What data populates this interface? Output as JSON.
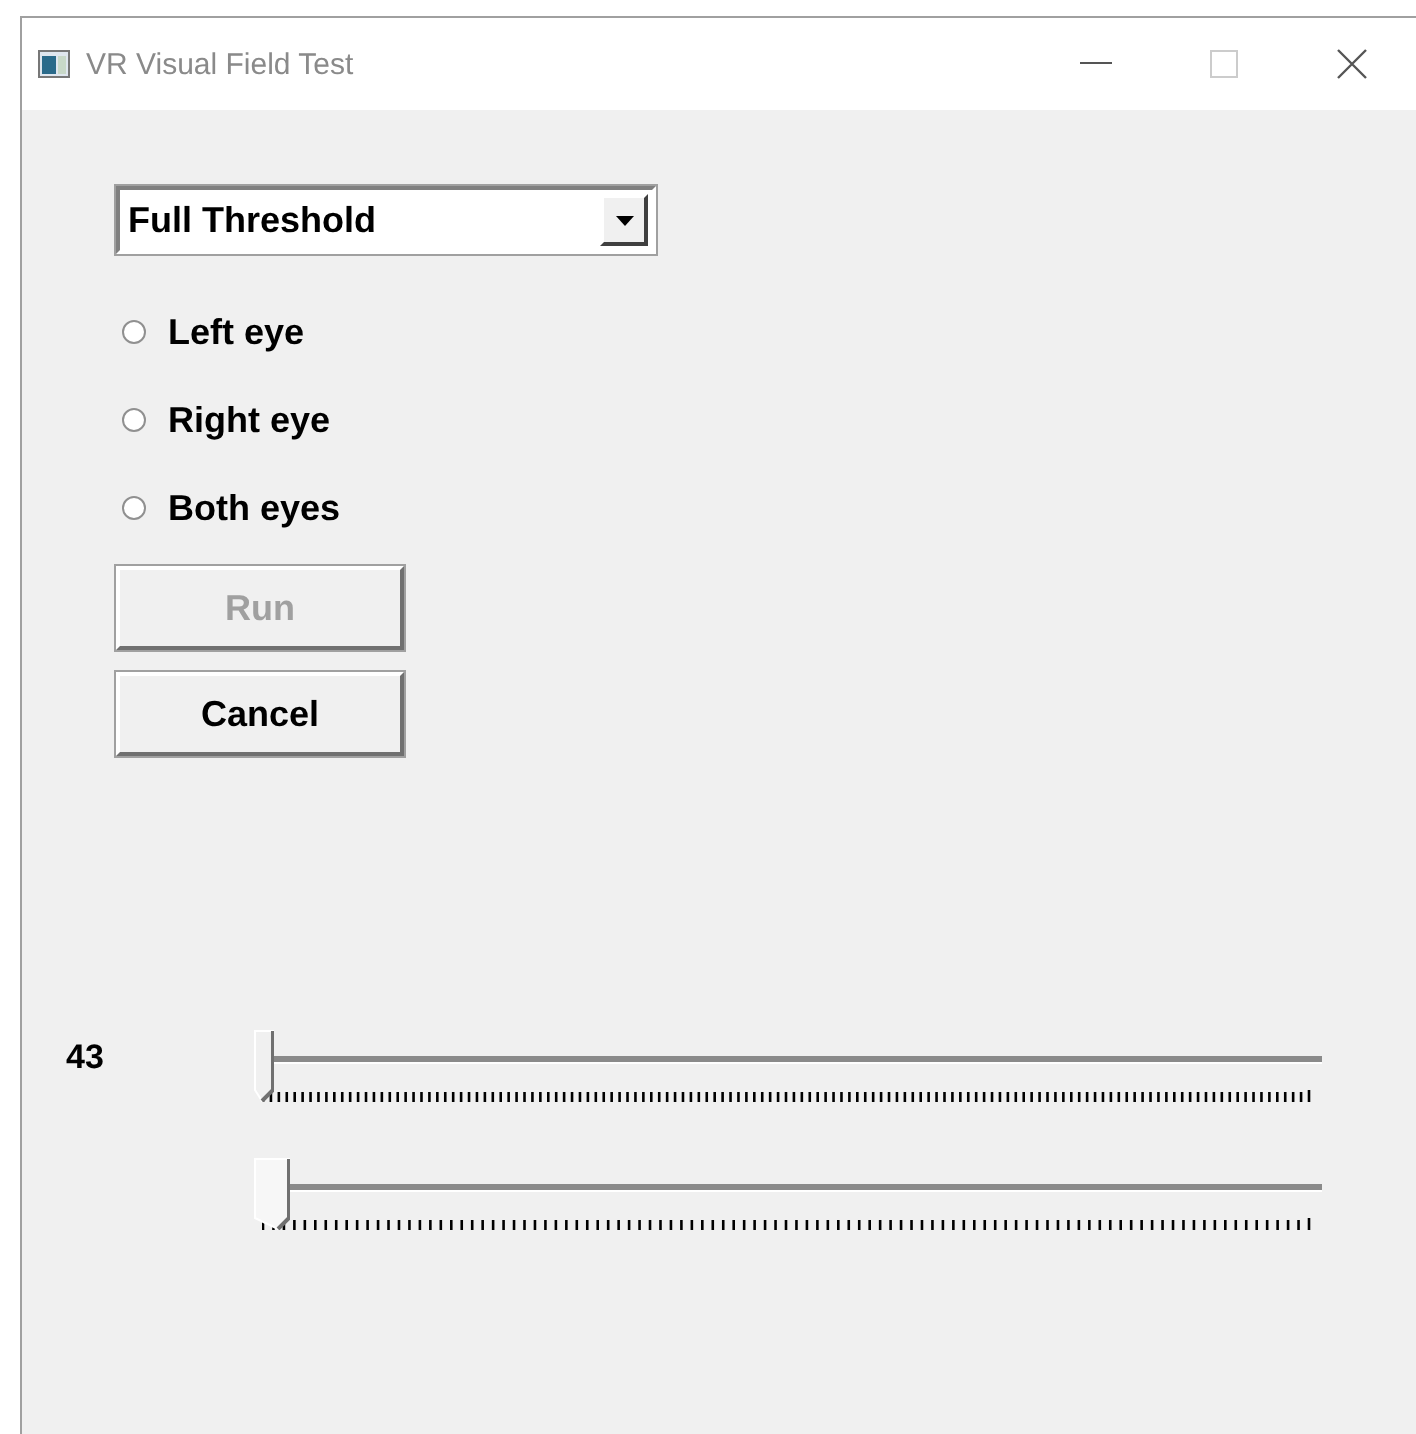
{
  "window": {
    "title": "VR Visual Field Test"
  },
  "test_type": {
    "value": "Full Threshold"
  },
  "eye_options": [
    {
      "label": "Left eye",
      "selected": false
    },
    {
      "label": "Right eye",
      "selected": false
    },
    {
      "label": "Both eyes",
      "selected": false
    }
  ],
  "buttons": [
    {
      "label": "Run",
      "disabled": true
    },
    {
      "label": "Cancel",
      "disabled": false
    }
  ],
  "sliders": [
    {
      "reading": "43",
      "level": 0,
      "focused": false
    },
    {
      "level": 0,
      "focused": true
    }
  ]
}
